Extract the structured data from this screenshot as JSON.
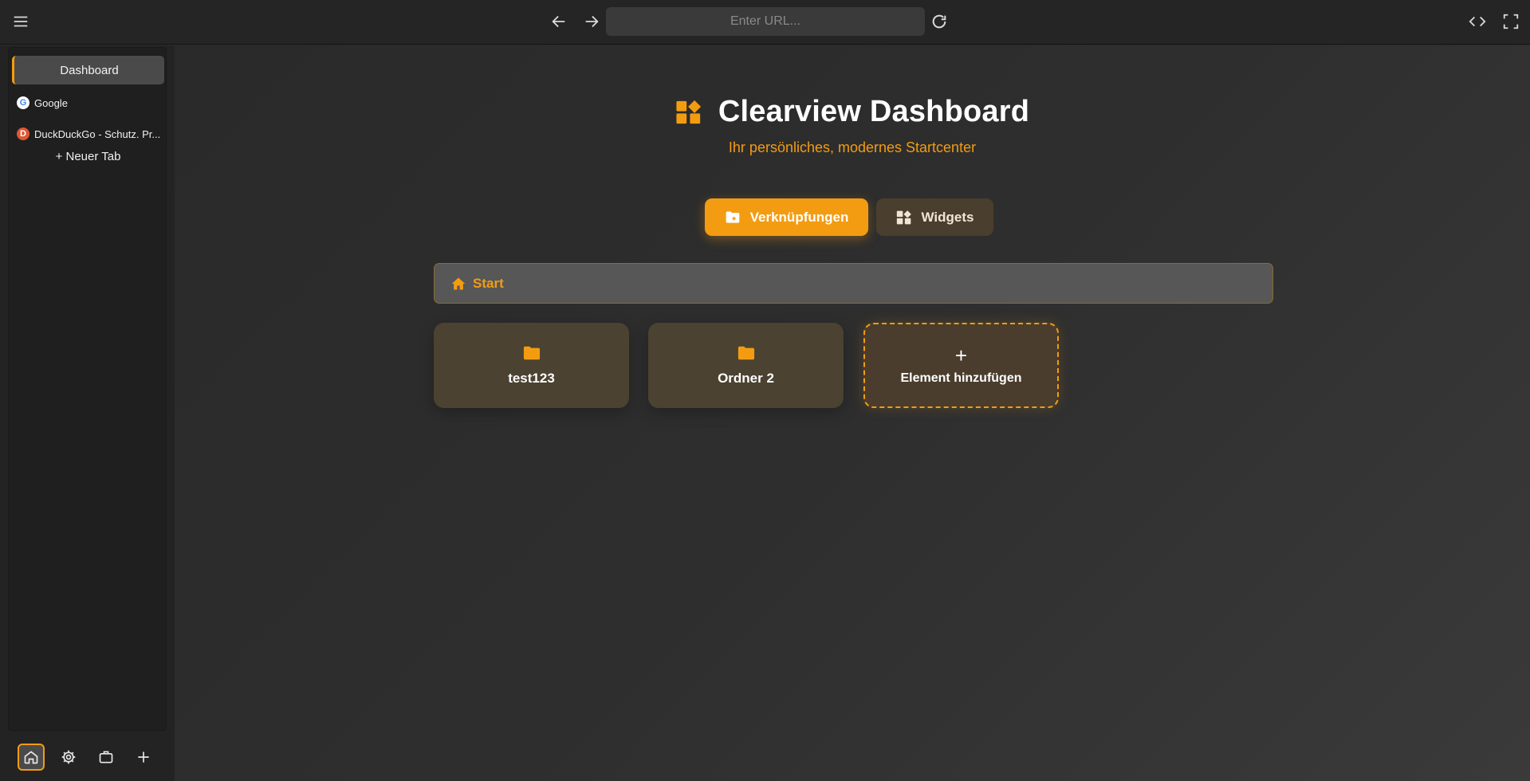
{
  "toolbar": {
    "menu_icon": "hamburger-icon",
    "back_icon": "arrow-left-icon",
    "forward_icon": "arrow-right-icon",
    "url_value": "",
    "url_placeholder": "Enter URL...",
    "reload_icon": "reload-icon",
    "devtools_icon": "code-icon",
    "fullscreen_icon": "fullscreen-icon"
  },
  "sidebar": {
    "tabs": [
      {
        "label": "Dashboard",
        "active": true
      },
      {
        "label": "Google",
        "favicon": "google-icon"
      },
      {
        "label": "DuckDuckGo - Schutz. Pr...",
        "favicon": "duckduckgo-icon"
      }
    ],
    "new_tab_label": "+ Neuer Tab",
    "bottom_icons": [
      "home-icon",
      "gear-icon",
      "briefcase-icon",
      "plus-icon"
    ]
  },
  "main": {
    "title": "Clearview Dashboard",
    "subtitle": "Ihr persönliches, modernes Startcenter",
    "modes": [
      {
        "label": "Verknüpfungen",
        "active": true
      },
      {
        "label": "Widgets",
        "active": false
      }
    ],
    "breadcrumb": "Start",
    "items": [
      {
        "label": "test123",
        "type": "folder"
      },
      {
        "label": "Ordner 2",
        "type": "folder"
      }
    ],
    "add_label": "Element hinzufügen",
    "add_plus": "+"
  },
  "colors": {
    "accent": "#f39c12",
    "background": "#2b2b2b",
    "card": "#4b4231"
  }
}
